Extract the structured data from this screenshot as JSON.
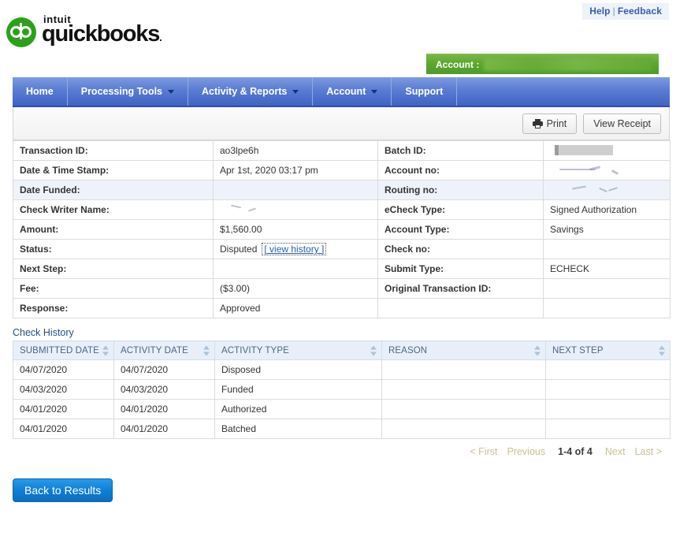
{
  "utility": {
    "help_label": "Help",
    "separator": "|",
    "feedback_label": "Feedback"
  },
  "brand": {
    "intuit": "intuit",
    "product": "quickbooks",
    "registered": "."
  },
  "account_strip": {
    "label": "Account :",
    "value_redacted": true,
    "color": "#5da72f"
  },
  "nav": {
    "items": [
      {
        "label": "Home",
        "has_caret": false
      },
      {
        "label": "Processing Tools",
        "has_caret": true
      },
      {
        "label": "Activity & Reports",
        "has_caret": true
      },
      {
        "label": "Account",
        "has_caret": true
      },
      {
        "label": "Support",
        "has_caret": false
      }
    ],
    "accent": "#3f63c4"
  },
  "toolbar": {
    "print_label": "Print",
    "view_receipt_label": "View Receipt"
  },
  "detail": {
    "rows": [
      {
        "left_label": "Transaction ID:",
        "left_value": "ao3lpe6h",
        "right_label": "Batch ID:",
        "right_value": "",
        "right_redact": "block",
        "shade": false
      },
      {
        "left_label": "Date & Time Stamp:",
        "left_value": "Apr 1st, 2020 03:17 pm",
        "right_label": "Account no:",
        "right_value": "",
        "right_redact": "scribble1",
        "shade": false
      },
      {
        "left_label": "Date Funded:",
        "left_value": "",
        "right_label": "Routing no:",
        "right_value": "",
        "right_redact": "scribble2",
        "shade": true
      },
      {
        "left_label": "Check Writer Name:",
        "left_value": "",
        "left_redact": "scribble3",
        "right_label": "eCheck Type:",
        "right_value": "Signed Authorization",
        "shade": false
      },
      {
        "left_label": "Amount:",
        "left_value": "$1,560.00",
        "right_label": "Account Type:",
        "right_value": "Savings",
        "shade": false
      },
      {
        "left_label": "Status:",
        "left_value": "Disputed",
        "left_link": "[ view history ]",
        "right_label": "Check no:",
        "right_value": "",
        "shade": false
      },
      {
        "left_label": "Next Step:",
        "left_value": "",
        "right_label": "Submit Type:",
        "right_value": "ECHECK",
        "shade": false
      },
      {
        "left_label": "Fee:",
        "left_value": "($3.00)",
        "right_label": "Original Transaction ID:",
        "right_value": "",
        "shade": false
      },
      {
        "left_label": "Response:",
        "left_value": "Approved",
        "right_label": "",
        "right_value": "",
        "shade": false
      }
    ]
  },
  "history": {
    "title": "Check History",
    "columns": [
      "SUBMITTED DATE",
      "ACTIVITY DATE",
      "ACTIVITY TYPE",
      "REASON",
      "NEXT STEP"
    ],
    "rows": [
      [
        "04/07/2020",
        "04/07/2020",
        "Disposed",
        "",
        ""
      ],
      [
        "04/03/2020",
        "04/03/2020",
        "Funded",
        "",
        ""
      ],
      [
        "04/01/2020",
        "04/01/2020",
        "Authorized",
        "",
        ""
      ],
      [
        "04/01/2020",
        "04/01/2020",
        "Batched",
        "",
        ""
      ]
    ]
  },
  "pager": {
    "first": "< First",
    "previous": "Previous",
    "count": "1-4 of 4",
    "next": "Next",
    "last": "Last >"
  },
  "footer": {
    "back_label": "Back to Results"
  }
}
